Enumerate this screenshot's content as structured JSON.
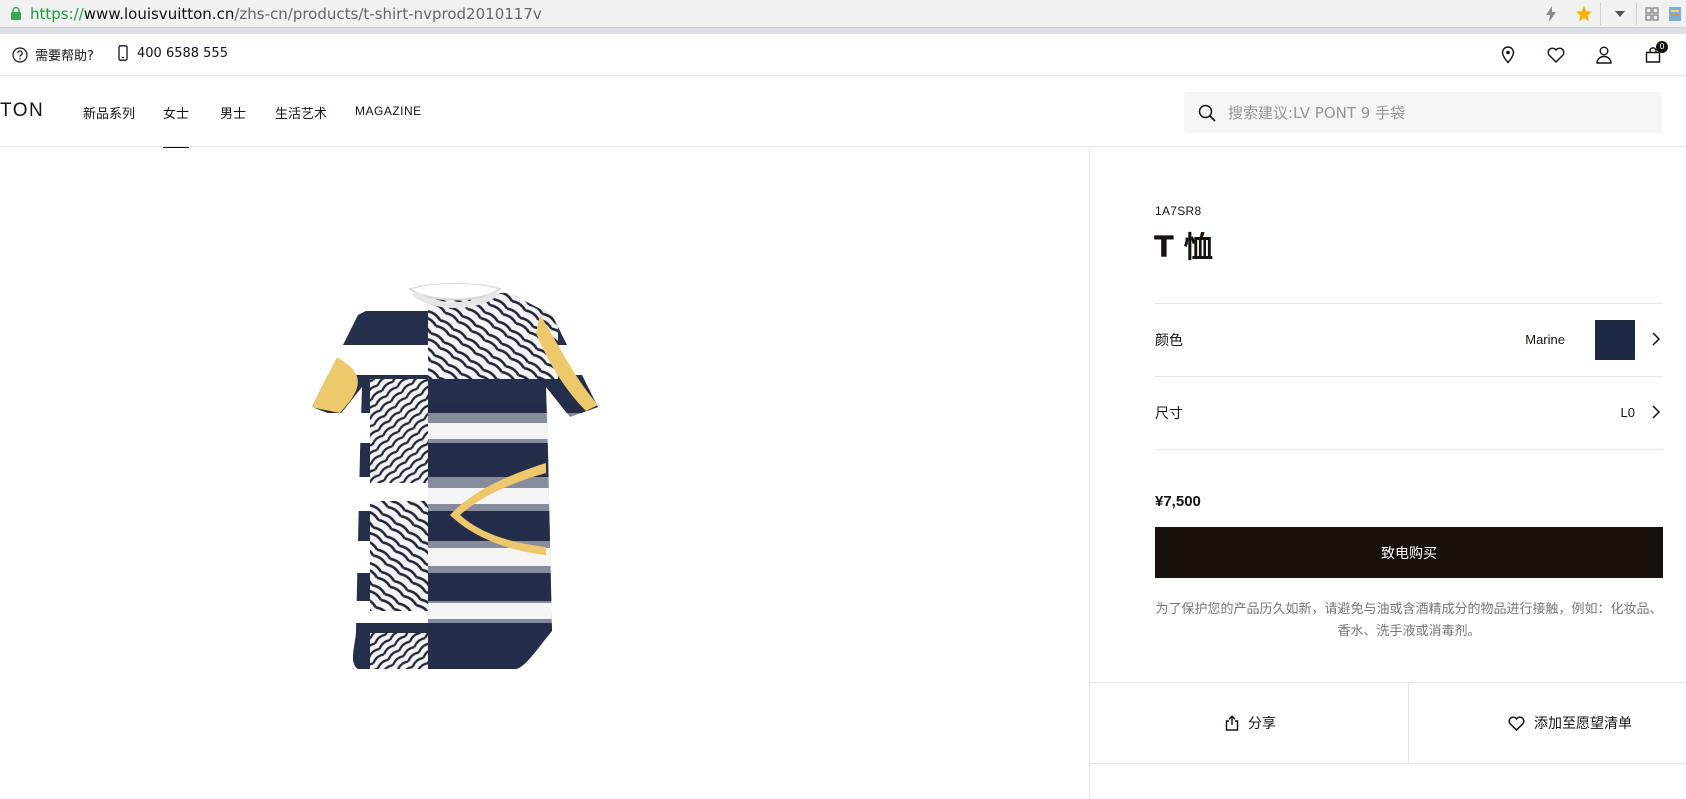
{
  "browser": {
    "url_scheme": "https",
    "url_sep": "://",
    "url_host": "www.louisvuitton.cn",
    "url_path": "/zhs-cn/products/t-shirt-nvprod2010117v"
  },
  "utility": {
    "help_label": "需要帮助?",
    "phone": "400 6588 555",
    "cart_count": "0"
  },
  "nav": {
    "brand": "TON",
    "items": [
      {
        "label": "新品系列"
      },
      {
        "label": "女士"
      },
      {
        "label": "男士"
      },
      {
        "label": "生活艺术"
      },
      {
        "label": "MAGAZINE"
      }
    ],
    "active_index": 1,
    "search_placeholder": "搜索建议:LV PONT 9 手袋"
  },
  "product": {
    "sku": "1A7SR8",
    "title": "T 恤",
    "color_label": "颜色",
    "color_value": "Marine",
    "size_label": "尺寸",
    "size_value": "L0",
    "price": "¥7,500",
    "buy_label": "致电购买",
    "care_text": "为了保护您的产品历久如新，请避免与油或含酒精成分的物品进行接触，例如：化妆品、香水、洗手液或消毒剂。",
    "share_label": "分享",
    "wishlist_label": "添加至愿望清单"
  },
  "colors": {
    "swatch": "#1c2944",
    "ink": "#19110b",
    "accent_yellow": "#ecc86a"
  }
}
